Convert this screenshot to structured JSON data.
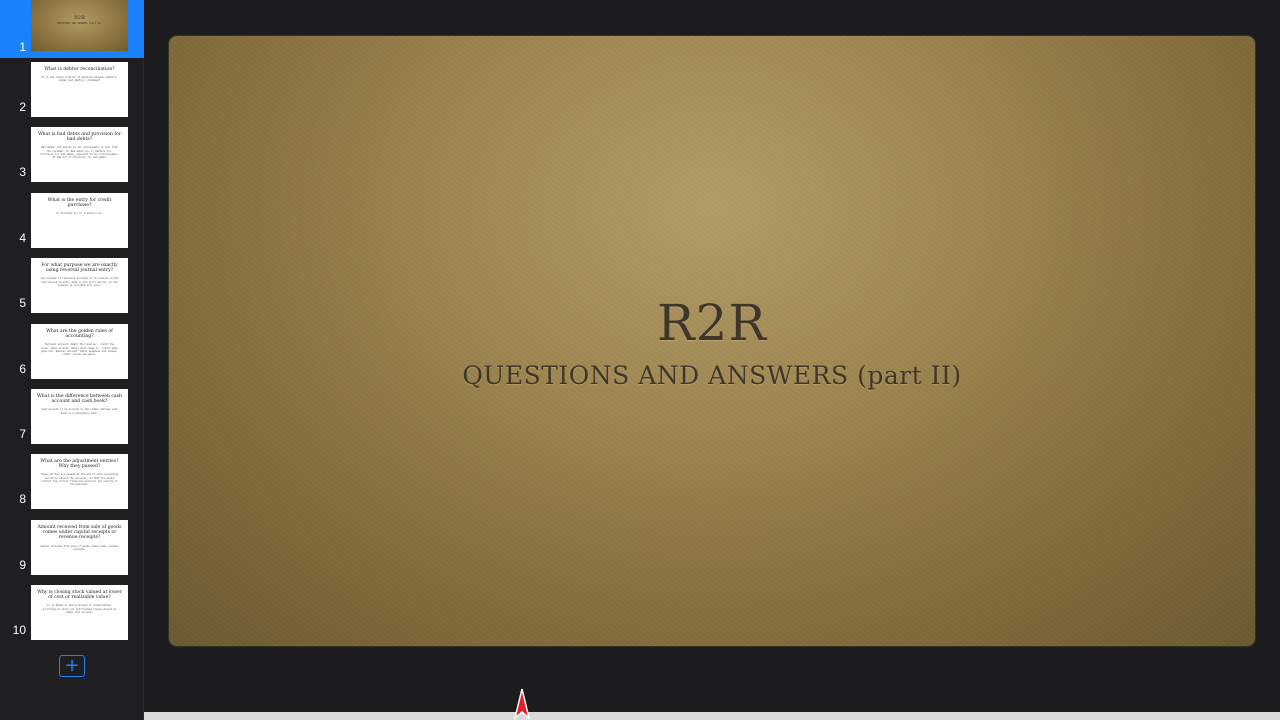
{
  "slides": [
    {
      "number": "1",
      "title": "R2R",
      "body": "QUESTIONS AND ANSWERS (part II)"
    },
    {
      "number": "2",
      "title": "What is debtor reconciliation?",
      "body": "It is the reconciliation of balances between debtors' ledger and debtors' statement"
    },
    {
      "number": "3",
      "title": "What is bad debts and provision for bad debts?",
      "body": "Bad debts: The amount is not recoverable in full from the customer. Dr Bad debts A/c Cr Debtors A/c. Provision for bad debts: expected to be irrecoverable. Dr P&L A/c Cr Provision for bad debts"
    },
    {
      "number": "4",
      "title": "What is the entry for credit purchase?",
      "body": "Dr Purchase A/c Cr Creditors A/c"
    },
    {
      "number": "5",
      "title": "For what purpose we are exactly using reversal journal entry?",
      "body": "The purpose of reversing accruals is to reverse in the next period an entry made in the prior period, so the expense is recorded only once."
    },
    {
      "number": "6",
      "title": "What are the golden rules of accounting?",
      "body": "Personal account: Debit the receiver, credit the giver. Real account: Debit what comes in, credit what goes out. Nominal account: Debit expenses and losses, credit income and gains."
    },
    {
      "number": "7",
      "title": "What is the difference between cash account and cash book?",
      "body": "Cash account is an account in the ledger whereas cash book is a subsidiary book."
    },
    {
      "number": "8",
      "title": "What are the adjustment entries? Why they passed?",
      "body": "These entries are passed at the end of each accounting period to adjust the accounts, so that the books reflect the correct financial position and results of the business."
    },
    {
      "number": "9",
      "title": "Amount received from sale of goods comes under capital receipts or revenue receipts?",
      "body": "Amount received from sale of goods comes under revenue receipts."
    },
    {
      "number": "10",
      "title": "Why is closing stock valued at lower of cost or realizable value?",
      "body": "It is based on the principle of conservatism, according to which all anticipated losses should be taken into account."
    }
  ],
  "current_slide": {
    "title": "R2R",
    "subtitle": "QUESTIONS AND ANSWERS (part II)"
  },
  "colors": {
    "accent": "#1a82fb",
    "sidebar_bg": "#1f1f21",
    "app_bg": "#1c1c1e",
    "slide_text": "#3d3628"
  },
  "icons": {
    "add_slide": "plus-icon",
    "cursor": "pointer-cursor-icon"
  }
}
